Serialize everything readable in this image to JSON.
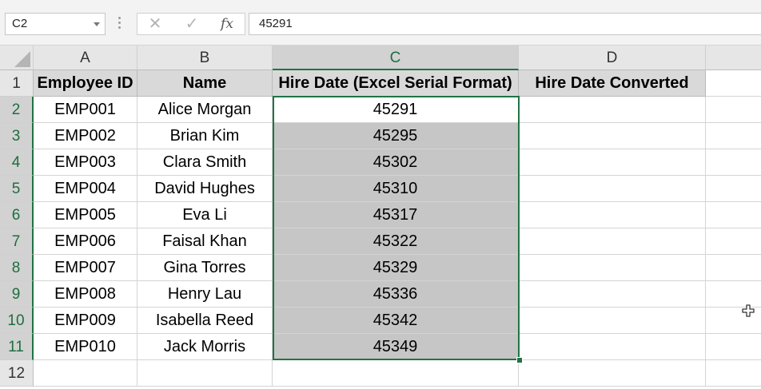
{
  "formula_bar": {
    "name_box": "C2",
    "cancel_icon": "✕",
    "enter_icon": "✓",
    "fx_label": "fx",
    "formula": "45291"
  },
  "columns": [
    {
      "letter": "A",
      "selected": false
    },
    {
      "letter": "B",
      "selected": false
    },
    {
      "letter": "C",
      "selected": true
    },
    {
      "letter": "D",
      "selected": false
    }
  ],
  "rows": [
    "1",
    "2",
    "3",
    "4",
    "5",
    "6",
    "7",
    "8",
    "9",
    "10",
    "11",
    "12"
  ],
  "selected_rows": [
    "2",
    "3",
    "4",
    "5",
    "6",
    "7",
    "8",
    "9",
    "10",
    "11"
  ],
  "headers": [
    "Employee ID",
    "Name",
    "Hire Date (Excel Serial Format)",
    "Hire Date Converted"
  ],
  "data_rows": [
    [
      "EMP001",
      "Alice Morgan",
      "45291",
      ""
    ],
    [
      "EMP002",
      "Brian Kim",
      "45295",
      ""
    ],
    [
      "EMP003",
      "Clara Smith",
      "45302",
      ""
    ],
    [
      "EMP004",
      "David Hughes",
      "45310",
      ""
    ],
    [
      "EMP005",
      "Eva Li",
      "45317",
      ""
    ],
    [
      "EMP006",
      "Faisal Khan",
      "45322",
      ""
    ],
    [
      "EMP007",
      "Gina Torres",
      "45329",
      ""
    ],
    [
      "EMP008",
      "Henry Lau",
      "45336",
      ""
    ],
    [
      "EMP009",
      "Isabella Reed",
      "45342",
      ""
    ],
    [
      "EMP010",
      "Jack Morris",
      "45349",
      ""
    ]
  ],
  "icons": {
    "dropdown": "chevron-down-icon",
    "cursor": "move-cross-cursor-icon"
  },
  "colors": {
    "selection_accent": "#217346",
    "selected_range_fill": "#c6c6c6",
    "header_fill": "#d9d9d9"
  }
}
